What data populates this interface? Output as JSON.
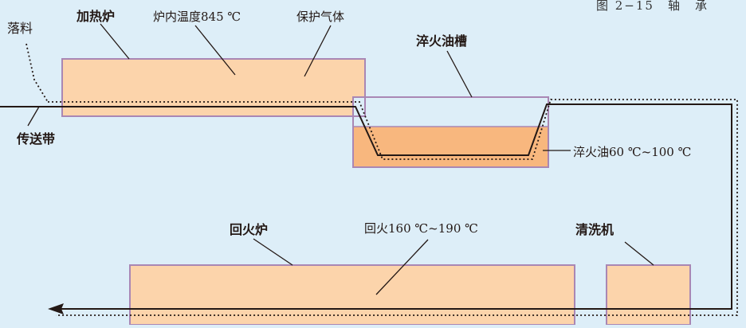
{
  "caption": "图 2−15　轴　承",
  "labels": {
    "falling_material": "落料",
    "heating_furnace": "加热炉",
    "furnace_temp": "炉内温度845 ℃",
    "protective_gas": "保护气体",
    "quench_tank": "淬火油槽",
    "conveyor_belt": "传送带",
    "quench_oil": "淬火油60 ℃~100 ℃",
    "tempering_furnace": "回火炉",
    "tempering_temp": "回火160 ℃~190 ℃",
    "washer": "清洗机"
  },
  "colors": {
    "background": "#ddeef8",
    "furnace_fill": "#fcd4ab",
    "box_border": "#a987b4",
    "oil_fill": "#f8b77e",
    "line": "#231815"
  }
}
